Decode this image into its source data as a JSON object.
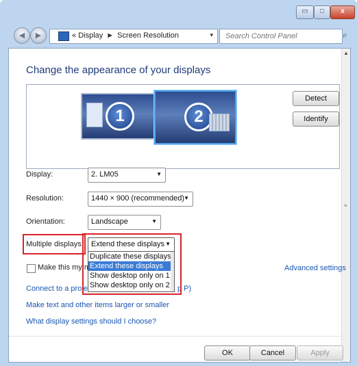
{
  "window": {
    "min_glyph": "▭",
    "max_glyph": "□",
    "close_glyph": "x"
  },
  "nav": {
    "back_glyph": "◀",
    "forward_glyph": "▶",
    "breadcrumb_prefix": "«",
    "breadcrumb": [
      "Display",
      "Screen Resolution"
    ],
    "breadcrumb_sep": "►",
    "address_drop_glyph": "▾",
    "refresh_glyph": "↻",
    "search_placeholder": "Search Control Panel",
    "search_glyph": "⌕"
  },
  "content": {
    "heading": "Change the appearance of your displays",
    "monitors": [
      {
        "number": "1",
        "selected": false
      },
      {
        "number": "2",
        "selected": true
      }
    ],
    "detect_label": "Detect",
    "identify_label": "Identify",
    "display": {
      "label": "Display:",
      "value": "2. LM05"
    },
    "resolution": {
      "label": "Resolution:",
      "value": "1440 × 900 (recommended)"
    },
    "orientation": {
      "label": "Orientation:",
      "value": "Landscape"
    },
    "multiple": {
      "label": "Multiple displays:",
      "value": "Extend these displays",
      "options": [
        "Duplicate these displays",
        "Extend these displays",
        "Show desktop only on 1",
        "Show desktop only on 2"
      ],
      "highlighted_index": 1
    },
    "make_main_label": "Make this my m",
    "advanced_link": "Advanced settings",
    "link_projector": "Connect to a proje",
    "link_projector_tail": "p P)",
    "link_text_size": "Make text and other items larger or smaller",
    "link_help": "What display settings should I choose?"
  },
  "buttons": {
    "ok": "OK",
    "cancel": "Cancel",
    "apply": "Apply"
  },
  "dropdown_arrow": "▼",
  "colors": {
    "accent": "#1f3c7a",
    "link": "#1a56b0",
    "highlight": "#3a7bd5",
    "annotation_red": "#d9222a"
  }
}
